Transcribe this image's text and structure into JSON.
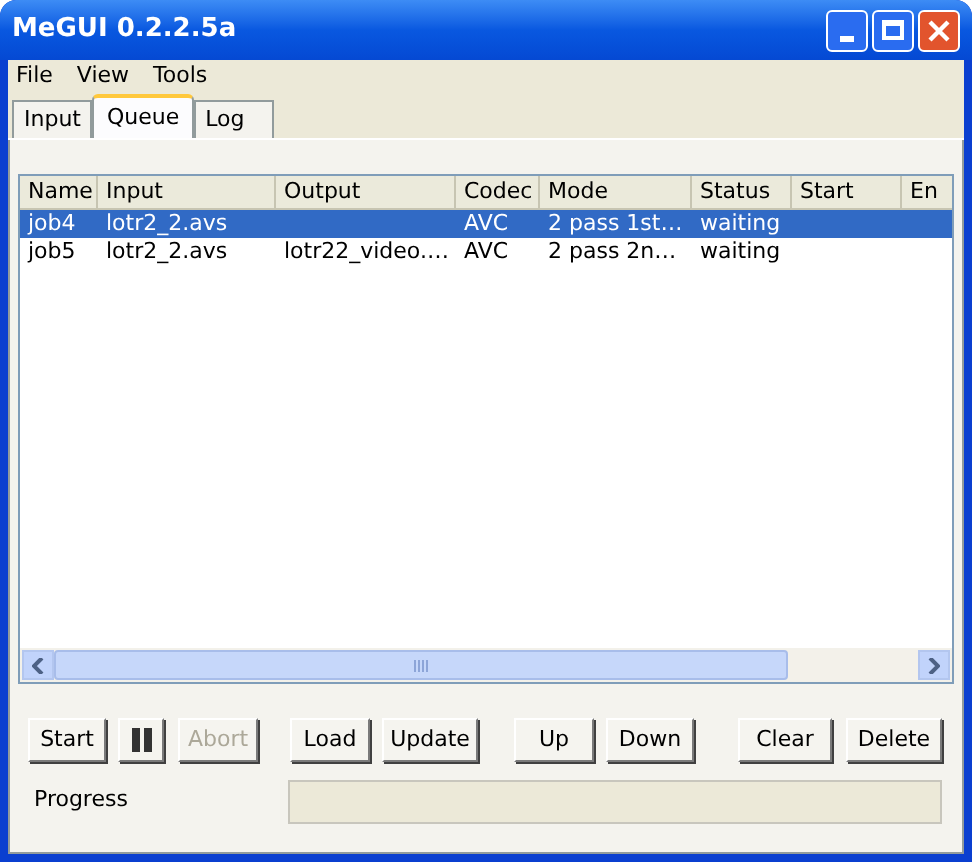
{
  "window": {
    "title": "MeGUI 0.2.2.5a"
  },
  "menu": [
    "File",
    "View",
    "Tools"
  ],
  "tabs": [
    {
      "label": "Input",
      "selected": false
    },
    {
      "label": "Queue",
      "selected": true
    },
    {
      "label": "Log",
      "selected": false
    }
  ],
  "table": {
    "columns": [
      "Name",
      "Input",
      "Output",
      "Codec",
      "Mode",
      "Status",
      "Start",
      "En"
    ],
    "rows": [
      {
        "cells": [
          "job4",
          "lotr2_2.avs",
          "",
          "AVC",
          "2 pass 1st…",
          "waiting",
          "",
          ""
        ],
        "selected": true
      },
      {
        "cells": [
          "job5",
          "lotr2_2.avs",
          "lotr22_video.…",
          "AVC",
          "2 pass 2n…",
          "waiting",
          "",
          ""
        ],
        "selected": false
      }
    ]
  },
  "buttons": [
    {
      "kind": "text",
      "label": "Start",
      "disabled": false
    },
    {
      "kind": "pause",
      "disabled": false
    },
    {
      "kind": "text",
      "label": "Abort",
      "disabled": true
    },
    {
      "kind": "text",
      "label": "Load",
      "disabled": false
    },
    {
      "kind": "text",
      "label": "Update",
      "disabled": false
    },
    {
      "kind": "text",
      "label": "Up",
      "disabled": false
    },
    {
      "kind": "text",
      "label": "Down",
      "disabled": false
    },
    {
      "kind": "text",
      "label": "Clear",
      "disabled": false
    },
    {
      "kind": "text",
      "label": "Delete",
      "disabled": false
    }
  ],
  "progress": {
    "label": "Progress"
  }
}
